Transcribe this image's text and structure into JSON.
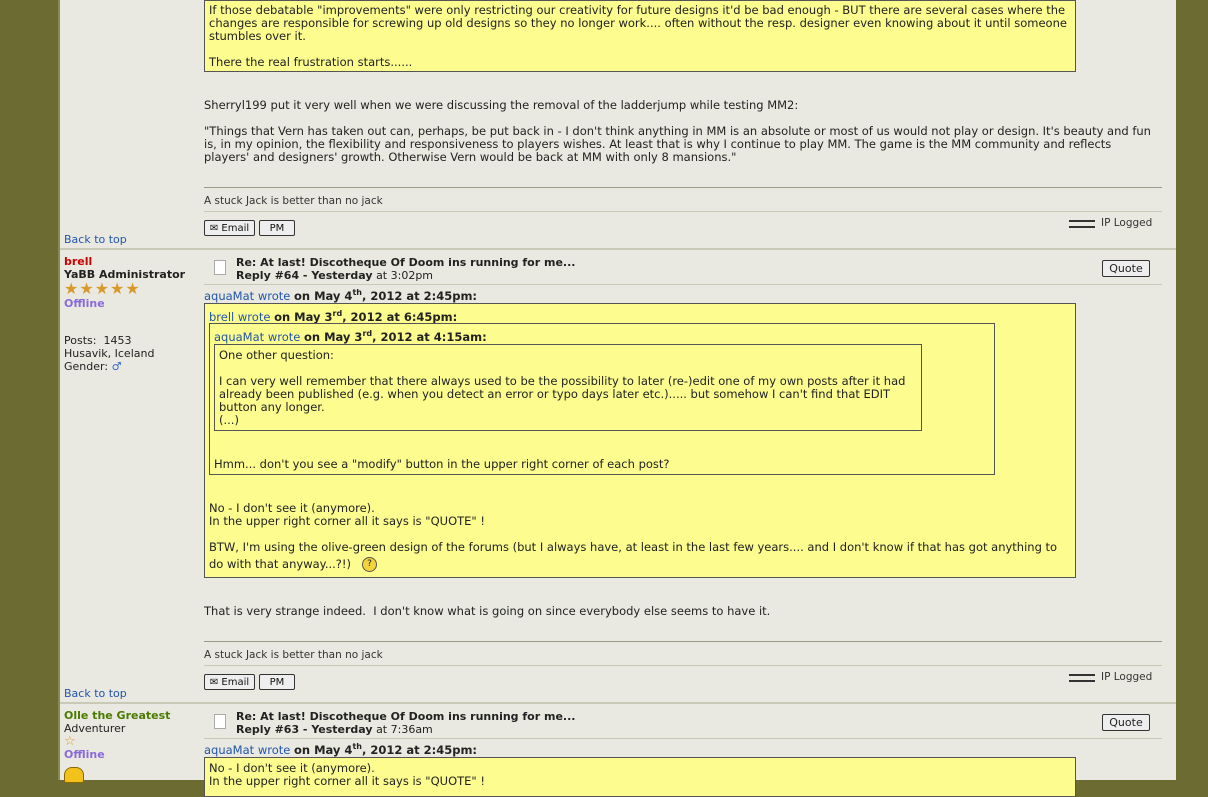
{
  "common": {
    "signature": "A stuck Jack is better than no jack",
    "back_to_top": "Back to top",
    "ip_logged": "IP Logged",
    "email_btn": "Email",
    "pm_btn": "PM",
    "quote_btn": "Quote"
  },
  "post_prev": {
    "quote_lines": [
      "If those debatable \"improvements\" were only restricting our creativity for future designs it'd be bad enough - BUT there are several cases where the",
      "changes are responsible for screwing up old designs so they no longer work.... often without the resp. designer even knowing about it until someone",
      "stumbles over it.",
      "There the real frustration starts......"
    ],
    "body_intro": "Sherryl199 put it very well when we were discussing the removal of the ladderjump while testing MM2:",
    "body_quote": "\"Things that Vern has taken out can, perhaps, be put back in - I don't think anything in MM is an absolute or most of us would not play or design. It's beauty and fun is, in my opinion, the flexibility and responsiveness to players wishes. At least that is why I continue to play MM. The game is the MM community and reflects players' and designers' growth. Otherwise Vern would be back at MM with only 8 mansions.\""
  },
  "post64": {
    "user": {
      "name": "brell",
      "rank": "YaBB Administrator",
      "stars": "★★★★★",
      "status": "Offline",
      "posts_label": "Posts:",
      "posts_value": "1453",
      "location": "Husavik, Iceland",
      "gender_label": "Gender:",
      "gender_icon": "♂"
    },
    "subject": "Re: At last! Discotheque Of Doom ins running for me...",
    "reply_no": "Reply #64 - Yesterday",
    "reply_time": "at 3:02pm",
    "outer_quote": {
      "who": "aquaMat wrote",
      "on": "on May 4",
      "sup": "th",
      "date_rest": ", 2012 at 2:45pm:"
    },
    "mid_quote": {
      "who": "brell wrote",
      "on": "on May 3",
      "sup": "rd",
      "date_rest": ", 2012 at 6:45pm:"
    },
    "inner_quote": {
      "who": "aquaMat wrote",
      "on": "on May 3",
      "sup": "rd",
      "date_rest": ", 2012 at 4:15am:",
      "line1": "One other question:",
      "line2": "I can very well remember that there always used to be the possibility to later (re-)edit one of my own posts after it had",
      "line3": "already been published (e.g. when you detect an error or typo days later etc.)..... but somehow I can't find that EDIT",
      "line4": "button any longer.",
      "line5": "(...)"
    },
    "mid_text": "Hmm... don't you see a \"modify\" button in the upper right corner of each post?",
    "outer_text1": "No - I don't see it (anymore).",
    "outer_text2": "In the upper right corner all it says is \"QUOTE\" !",
    "outer_text3": "BTW, I'm using the olive-green design of the forums (but I always have, at least in the last few years.... and I don't know if that has got anything to",
    "outer_text4": "do with that anyway...?!)",
    "body": "That is very strange indeed.  I don't know what is going on since everybody else seems to have it."
  },
  "post63": {
    "user": {
      "name": "Olle the Greatest",
      "rank": "Adventurer",
      "stars": "☆",
      "status": "Offline"
    },
    "subject": "Re: At last! Discotheque Of Doom ins running for me...",
    "reply_no": "Reply #63 - Yesterday",
    "reply_time": "at 7:36am",
    "quote": {
      "who": "aquaMat wrote",
      "on": "on May 4",
      "sup": "th",
      "date_rest": ", 2012 at 2:45pm:",
      "line1": "No - I don't see it (anymore).",
      "line2": "In the upper right corner all it says is \"QUOTE\" !"
    }
  }
}
